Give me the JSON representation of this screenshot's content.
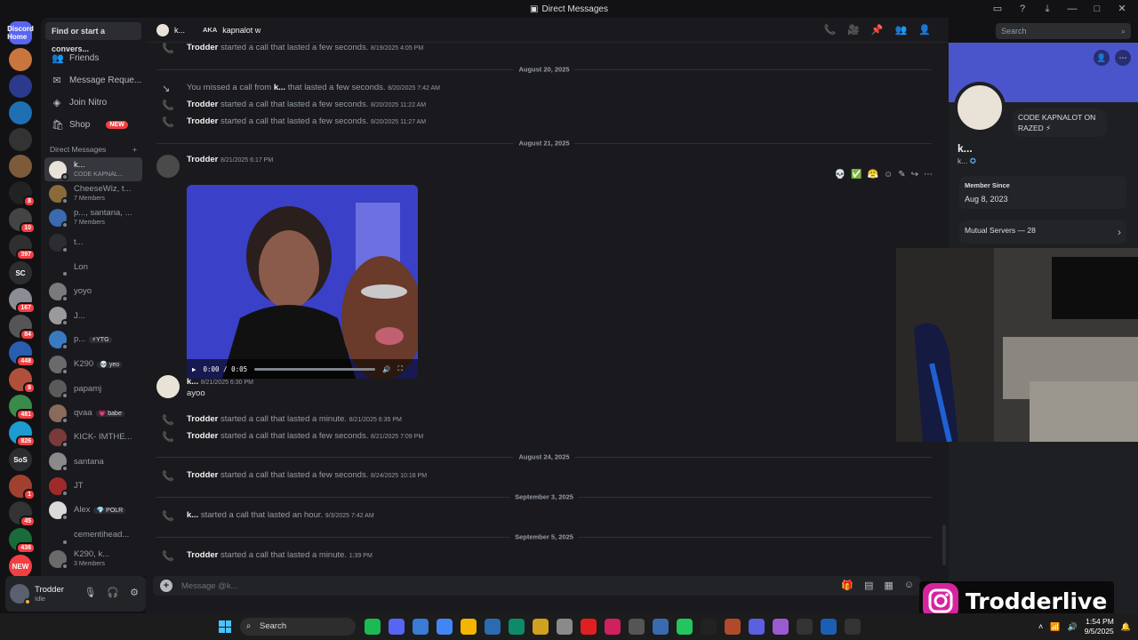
{
  "window": {
    "title": "Direct Messages",
    "controls": [
      "—",
      "□",
      "✕"
    ]
  },
  "servers": [
    {
      "name": "Discord Home",
      "color": "#5865f2",
      "badge": ""
    },
    {
      "name": "",
      "color": "#c9753e",
      "badge": ""
    },
    {
      "name": "",
      "color": "#2b3a8c",
      "badge": ""
    },
    {
      "name": "",
      "color": "#1f6fb5",
      "badge": ""
    },
    {
      "name": "",
      "color": "#333333",
      "badge": ""
    },
    {
      "name": "",
      "color": "#7b5b3a",
      "badge": ""
    },
    {
      "name": "",
      "color": "#222222",
      "badge": "8"
    },
    {
      "name": "",
      "color": "#444444",
      "badge": "10"
    },
    {
      "name": "",
      "color": "#2f2f2f",
      "badge": "397"
    },
    {
      "name": "SC",
      "color": "#2b2d31",
      "badge": ""
    },
    {
      "name": "",
      "color": "#8a8d93",
      "badge": "167"
    },
    {
      "name": "",
      "color": "#555",
      "badge": "84"
    },
    {
      "name": "",
      "color": "#2a5db0",
      "badge": "448"
    },
    {
      "name": "",
      "color": "#b0503a",
      "badge": "8"
    },
    {
      "name": "",
      "color": "#3a8a4a",
      "badge": "481"
    },
    {
      "name": "",
      "color": "#1d9bd1",
      "badge": "826"
    },
    {
      "name": "SoS",
      "color": "#2b2d31",
      "badge": ""
    },
    {
      "name": "",
      "color": "#a04030",
      "badge": "1"
    },
    {
      "name": "",
      "color": "#333",
      "badge": "45"
    },
    {
      "name": "",
      "color": "#1a6b3a",
      "badge": "438"
    },
    {
      "name": "NEW",
      "color": "#f23f42",
      "badge": ""
    }
  ],
  "sidebar": {
    "search_placeholder": "Find or start a convers...",
    "nav": [
      {
        "icon": "👥",
        "label": "Friends"
      },
      {
        "icon": "✉",
        "label": "Message Reque..."
      },
      {
        "icon": "◈",
        "label": "Join Nitro"
      },
      {
        "icon": "🛍",
        "label": "Shop",
        "tag": "NEW"
      }
    ],
    "dm_header": "Direct Messages",
    "dm_add": "+",
    "dms": [
      {
        "name": "k...",
        "sub": "CODE KAPNAL...",
        "color": "#e9e2d6",
        "active": true
      },
      {
        "name": "CheeseWiz, t...",
        "sub": "7 Members",
        "color": "#8a6a3a"
      },
      {
        "name": "p..., santana, ...",
        "sub": "7 Members",
        "color": "#3a6ab0"
      },
      {
        "name": "t...",
        "sub": "",
        "color": "#2b2d31"
      },
      {
        "name": "Lon",
        "sub": "",
        "color": "#1a1a1e"
      },
      {
        "name": "yoyo",
        "sub": "",
        "color": "#7a7a7a"
      },
      {
        "name": "J...",
        "sub": "",
        "color": "#9a9a9a"
      },
      {
        "name": "p...",
        "sub": "",
        "tag": "⚡YTG",
        "color": "#3a7ac0"
      },
      {
        "name": "K290",
        "sub": "",
        "tag": "💀 yeo",
        "color": "#6a6a6a"
      },
      {
        "name": "papamj",
        "sub": "",
        "color": "#5a5a5a"
      },
      {
        "name": "qvaa",
        "sub": "",
        "tag": "💗 babe",
        "color": "#8a6a5a"
      },
      {
        "name": "KICK- IMTHE...",
        "sub": "",
        "color": "#7a3a3a"
      },
      {
        "name": "santana",
        "sub": "",
        "color": "#8a8a8a"
      },
      {
        "name": "JT",
        "sub": "",
        "color": "#a02a2a"
      },
      {
        "name": "Alex",
        "sub": "",
        "tag": "💎 POLR",
        "color": "#dadada"
      },
      {
        "name": "cementihead...",
        "sub": "",
        "color": "#1a1a1e"
      },
      {
        "name": "K290, k...",
        "sub": "3 Members",
        "color": "#6a6a6a"
      }
    ]
  },
  "user": {
    "name": "Trodder",
    "status": "Idle"
  },
  "header": {
    "name": "k...",
    "aka_label": "AKA",
    "aka_value": "kapnalot w",
    "search_placeholder": "Search"
  },
  "messages": {
    "rows": [
      {
        "type": "call",
        "user": "Trodder",
        "text": "started a call that lasted a few seconds.",
        "ts": "8/19/2025 4:05 PM"
      },
      {
        "type": "divider",
        "text": "August 20, 2025"
      },
      {
        "type": "missed",
        "prefix": "You missed a call from",
        "user": "k...",
        "text": "that lasted a few seconds.",
        "ts": "8/20/2025 7:42 AM"
      },
      {
        "type": "call",
        "user": "Trodder",
        "text": "started a call that lasted a few seconds.",
        "ts": "8/20/2025 11:22 AM"
      },
      {
        "type": "call",
        "user": "Trodder",
        "text": "started a call that lasted a few seconds.",
        "ts": "8/20/2025 11:27 AM"
      },
      {
        "type": "divider",
        "text": "August 21, 2025"
      },
      {
        "type": "msg",
        "user": "Trodder",
        "ts": "8/21/2025 6:17 PM"
      },
      {
        "type": "msg",
        "user": "k...",
        "ts": "8/21/2025 6:30 PM",
        "text": "ayoo"
      },
      {
        "type": "call",
        "user": "Trodder",
        "text": "started a call that lasted a minute.",
        "ts": "8/21/2025 6:35 PM"
      },
      {
        "type": "call",
        "user": "Trodder",
        "text": "started a call that lasted a few seconds.",
        "ts": "8/21/2025 7:09 PM"
      },
      {
        "type": "divider",
        "text": "August 24, 2025"
      },
      {
        "type": "call",
        "user": "Trodder",
        "text": "started a call that lasted a few seconds.",
        "ts": "8/24/2025 10:18 PM"
      },
      {
        "type": "divider",
        "text": "September 3, 2025"
      },
      {
        "type": "call",
        "user": "k...",
        "text": "started a call that lasted an hour.",
        "ts": "9/3/2025 7:42 AM"
      },
      {
        "type": "divider",
        "text": "September 5, 2025"
      },
      {
        "type": "call",
        "user": "Trodder",
        "text": "started a call that lasted a minute.",
        "ts": "1:39 PM"
      }
    ],
    "video_time": "0:00 / 0:05",
    "reactions": [
      "💀",
      "✅",
      "😤",
      "☺",
      "✎",
      "↪",
      "⋯"
    ]
  },
  "composer": {
    "placeholder": "Message @k..."
  },
  "profile": {
    "name": "k...",
    "sub": "k...",
    "status_text": "CODE KAPNALOT ON RAZED ⚡",
    "member_since_label": "Member Since",
    "member_since": "Aug 8, 2023",
    "mutual_servers": "Mutual Servers — 28"
  },
  "watermark": "Trodderlive",
  "taskbar": {
    "search": "Search",
    "time": "1:54 PM",
    "date": "9/5/2025"
  },
  "colors": {
    "accent": "#5865f2",
    "call_green": "#23a55a",
    "alert_red": "#f23f42"
  }
}
